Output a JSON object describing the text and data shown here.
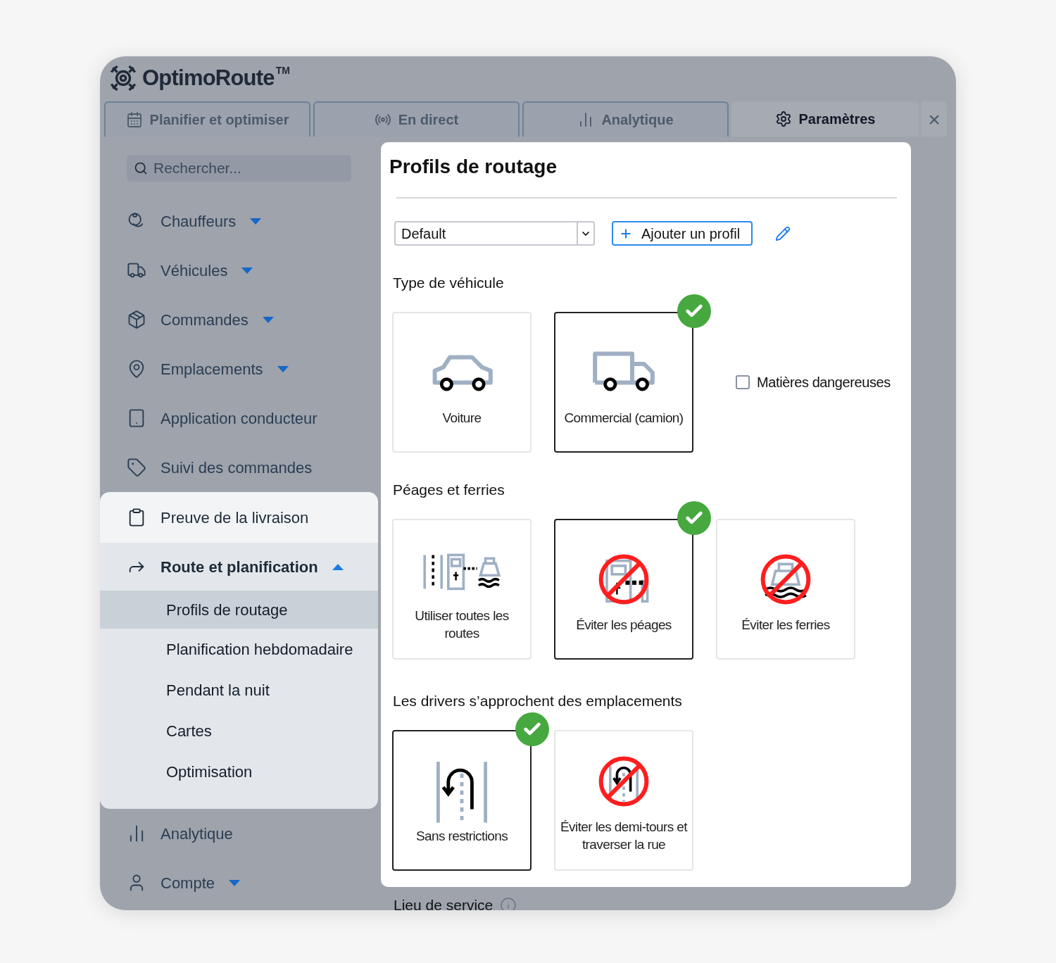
{
  "header": {
    "logo_text": "OptimoRoute",
    "trademark": "TM"
  },
  "tabs": [
    {
      "label": "Planifier et optimiser",
      "selected": false
    },
    {
      "label": "En direct",
      "selected": false
    },
    {
      "label": "Analytique",
      "selected": false
    },
    {
      "label": "Paramètres",
      "selected": true
    }
  ],
  "close_label": "×",
  "sidebar": {
    "search": {
      "placeholder": "Rechercher..."
    },
    "items": [
      {
        "label": "Chauffeurs",
        "expanded": false,
        "hovered": false
      },
      {
        "label": "Véhicules",
        "expanded": false,
        "hovered": false
      },
      {
        "label": "Commandes",
        "expanded": false,
        "hovered": false
      },
      {
        "label": "Emplacements",
        "expanded": false,
        "hovered": false
      },
      {
        "label": "Application conducteur",
        "hovered": false
      },
      {
        "label": "Suivi des commandes",
        "hovered": false
      },
      {
        "label": "Preuve de la livraison",
        "hovered": true
      },
      {
        "label": "Route et planification",
        "expanded": true,
        "hovered": false,
        "children": [
          {
            "label": "Profils de routage",
            "selected": true
          },
          {
            "label": "Planification hebdomadaire",
            "selected": false
          },
          {
            "label": "Pendant la nuit",
            "selected": false
          },
          {
            "label": "Cartes",
            "selected": false
          },
          {
            "label": "Optimisation",
            "selected": false
          }
        ]
      },
      {
        "label": "Analytique",
        "hovered": false
      },
      {
        "label": "Compte",
        "expanded": false,
        "hovered": false
      }
    ]
  },
  "panel": {
    "title": "Profils de routage",
    "profile_select": {
      "value": "Default"
    },
    "add_button": "Ajouter un profil",
    "sections": [
      {
        "title": "Type de véhicule",
        "options": [
          {
            "label": "Voiture",
            "selected": false
          },
          {
            "label": "Commercial (camion)",
            "selected": true
          }
        ],
        "checkbox": {
          "label": "Matières dangereuses",
          "checked": false
        }
      },
      {
        "title": "Péages et ferries",
        "options": [
          {
            "label": "Utiliser toutes les routes",
            "selected": false
          },
          {
            "label": "Éviter les péages",
            "selected": true
          },
          {
            "label": "Éviter les ferries",
            "selected": false
          }
        ]
      },
      {
        "title": "Les drivers s’approchent des emplacements",
        "options": [
          {
            "label": "Sans restrictions",
            "selected": true
          },
          {
            "label": "Éviter les demi-tours et traverser la rue",
            "selected": false
          }
        ]
      }
    ]
  },
  "footer_section": {
    "title": "Lieu de service"
  }
}
